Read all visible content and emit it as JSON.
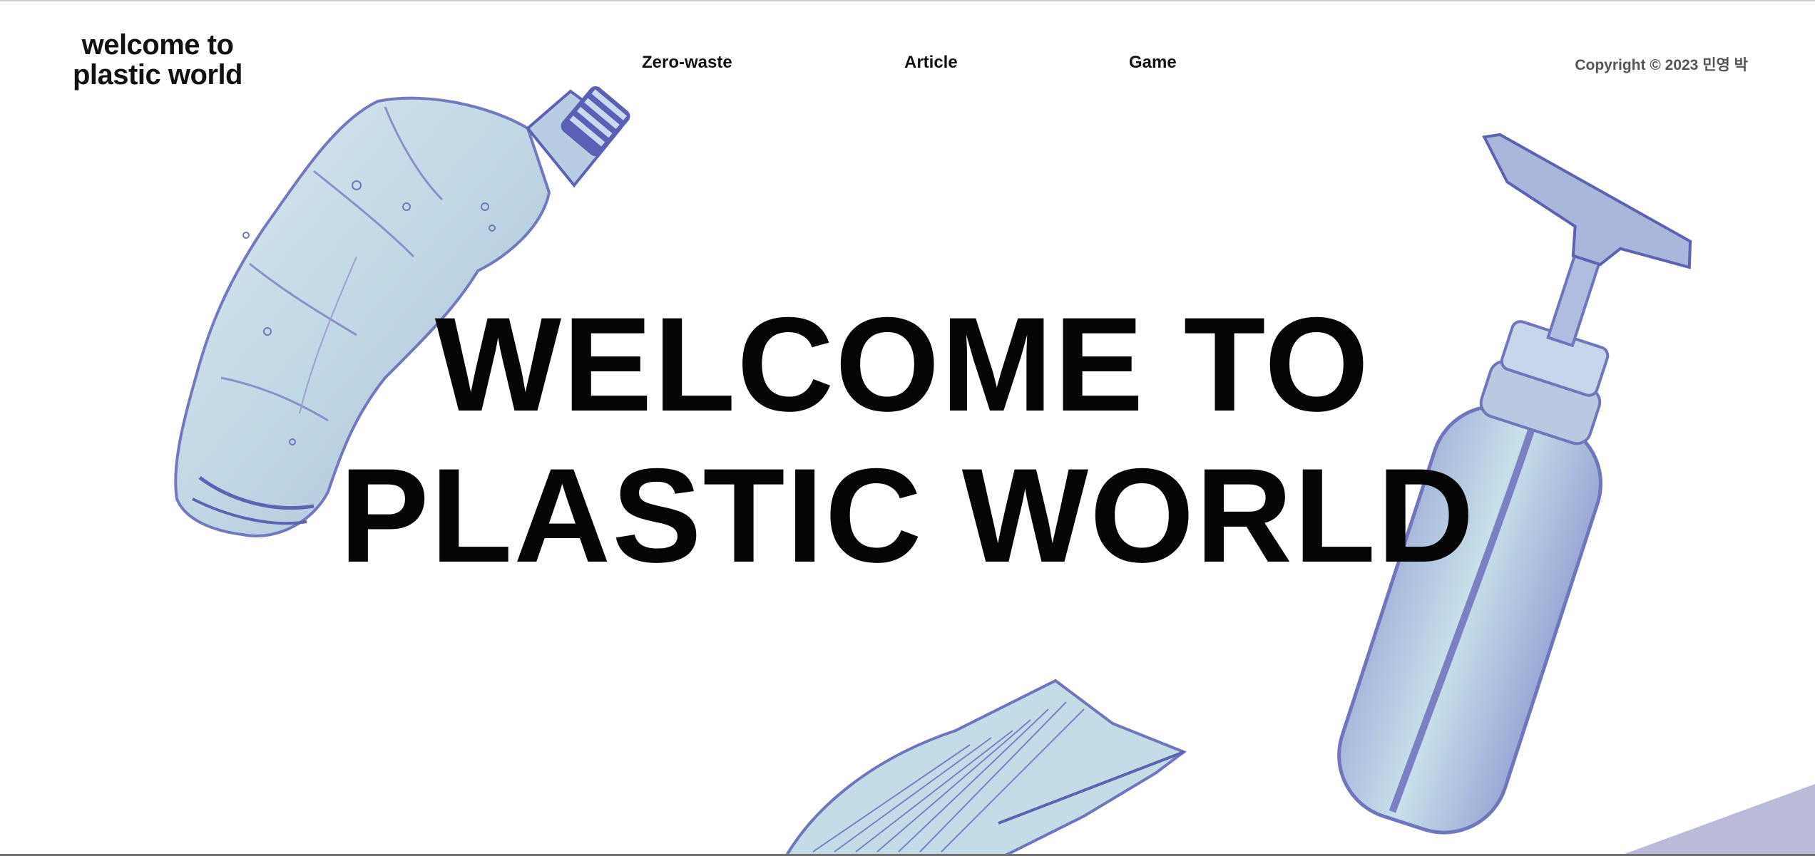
{
  "header": {
    "logo_line1": "welcome to",
    "logo_line2": "plastic world",
    "nav": [
      {
        "label": "Zero-waste"
      },
      {
        "label": "Article"
      },
      {
        "label": "Game"
      }
    ],
    "copyright": "Copyright © 2023 민영 박"
  },
  "hero": {
    "line1": "WELCOME TO",
    "line2": "PLASTIC WORLD"
  },
  "theme": {
    "plastic_fill": "#c3dce8",
    "plastic_stroke": "#5c63b0",
    "accent_shape": "#b9bbd8"
  },
  "images": [
    "crushed-bottle-image",
    "pump-bottle-image",
    "plastic-container-image"
  ]
}
